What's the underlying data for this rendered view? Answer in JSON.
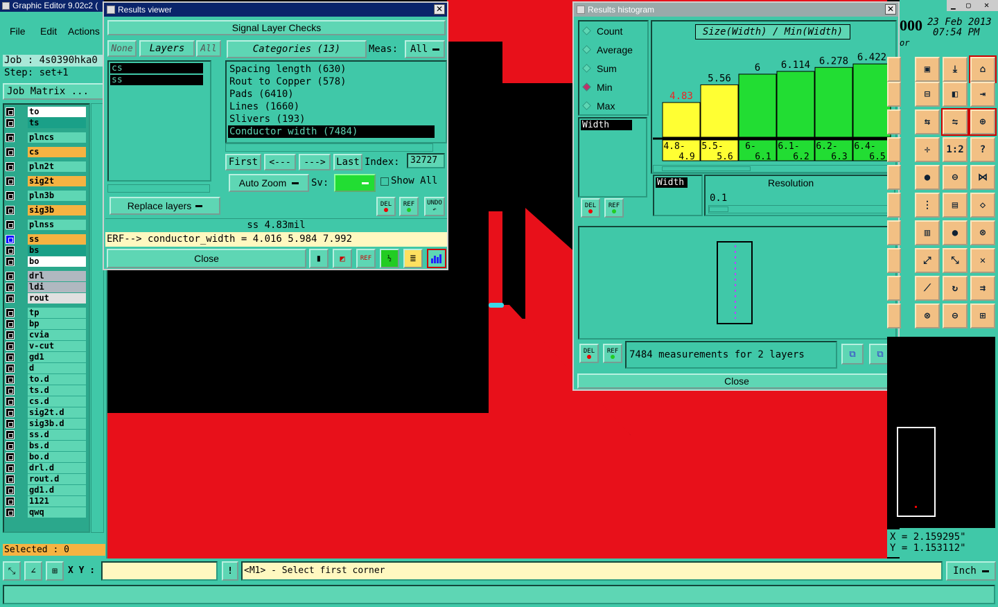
{
  "app": {
    "title": "Graphic Editor 9.02c2 (",
    "menus": [
      "File",
      "Edit",
      "Actions"
    ],
    "job": "Job : 4s0390hka0",
    "step": "Step: set+1",
    "job_matrix": "Job Matrix ...",
    "selected": "Selected : 0",
    "date": "23 Feb 2013",
    "time": "07:54 PM",
    "clock": "000",
    "clock_sub": "or"
  },
  "layers": [
    {
      "name": "to",
      "bg": "#ffffff"
    },
    {
      "name": "ts",
      "bg": "#1aa088"
    },
    {
      "name": "plncs",
      "bg": "#5ed6b4"
    },
    {
      "name": "cs",
      "bg": "#f5b342"
    },
    {
      "name": "pln2t",
      "bg": "#5ed6b4"
    },
    {
      "name": "sig2t",
      "bg": "#f5b342"
    },
    {
      "name": "pln3b",
      "bg": "#5ed6b4"
    },
    {
      "name": "sig3b",
      "bg": "#f5b342"
    },
    {
      "name": "plnss",
      "bg": "#5ed6b4"
    },
    {
      "name": "ss",
      "bg": "#f5b342"
    },
    {
      "name": "bs",
      "bg": "#1aa088"
    },
    {
      "name": "bo",
      "bg": "#ffffff"
    },
    {
      "name": "drl",
      "bg": "#b0b8c0"
    },
    {
      "name": "ldi",
      "bg": "#b0b8c0"
    },
    {
      "name": "rout",
      "bg": "#e0e0e0"
    },
    {
      "name": "tp",
      "bg": "#5ed6b4"
    },
    {
      "name": "bp",
      "bg": "#5ed6b4"
    },
    {
      "name": "cvia",
      "bg": "#5ed6b4"
    },
    {
      "name": "v-cut",
      "bg": "#5ed6b4"
    },
    {
      "name": "gd1",
      "bg": "#5ed6b4"
    },
    {
      "name": "d",
      "bg": "#5ed6b4"
    },
    {
      "name": "to.d",
      "bg": "#5ed6b4"
    },
    {
      "name": "ts.d",
      "bg": "#5ed6b4"
    },
    {
      "name": "cs.d",
      "bg": "#5ed6b4"
    },
    {
      "name": "sig2t.d",
      "bg": "#5ed6b4"
    },
    {
      "name": "sig3b.d",
      "bg": "#5ed6b4"
    },
    {
      "name": "ss.d",
      "bg": "#5ed6b4"
    },
    {
      "name": "bs.d",
      "bg": "#5ed6b4"
    },
    {
      "name": "bo.d",
      "bg": "#5ed6b4"
    },
    {
      "name": "drl.d",
      "bg": "#5ed6b4"
    },
    {
      "name": "rout.d",
      "bg": "#5ed6b4"
    },
    {
      "name": "gd1.d",
      "bg": "#5ed6b4"
    },
    {
      "name": "1121",
      "bg": "#5ed6b4"
    },
    {
      "name": "qwq",
      "bg": "#5ed6b4"
    }
  ],
  "results_viewer": {
    "title": "Results viewer",
    "header": "Signal Layer Checks",
    "btn_none": "None",
    "btn_layers": "Layers",
    "btn_all": "All",
    "categories_btn": "Categories (13)",
    "meas_label": "Meas:",
    "meas_value": "All",
    "layers_list": [
      "cs",
      "ss"
    ],
    "categories": [
      "Spacing length (630)",
      "Rout to Copper (578)",
      "Pads (6410)",
      "Lines (1660)",
      "Slivers (193)",
      "Conductor width (7484)"
    ],
    "nav": {
      "first": "First",
      "prev": "<---",
      "next": "--->",
      "last": "Last",
      "index_label": "Index:",
      "index_value": "32727"
    },
    "auto_zoom": "Auto Zoom",
    "sv_label": "Sv:",
    "show_all": "Show All",
    "replace_layers": "Replace layers",
    "del": "DEL",
    "ref": "REF",
    "undo": "UNDO",
    "status": "ss 4.83mil",
    "erf": "ERF--> conductor_width = 4.016 5.984 7.992",
    "close": "Close"
  },
  "histogram": {
    "title": "Results histogram",
    "chart_title": "Size(Width) / Min(Width)",
    "modes": [
      "Count",
      "Average",
      "Sum",
      "Min",
      "Max"
    ],
    "selected_mode": "Min",
    "list_item": "Width",
    "sel_field": "Width",
    "resolution_label": "Resolution",
    "resolution_value": "0.1",
    "del": "DEL",
    "ref": "REF",
    "summary": "7484 measurements for 2 layers",
    "close": "Close"
  },
  "chart_data": {
    "type": "bar",
    "title": "Size(Width) / Min(Width)",
    "categories": [
      "4.8-4.9",
      "5.5-5.6",
      "6-6.1",
      "6.1-6.2",
      "6.2-6.3",
      "6.4-6.5"
    ],
    "cat_top": [
      "4.8-",
      "5.5-",
      "6-",
      "6.1-",
      "6.2-",
      "6.4-"
    ],
    "cat_bottom": [
      "4.9",
      "5.6",
      "6.1",
      "6.2",
      "6.3",
      "6.5"
    ],
    "values": [
      4.83,
      5.56,
      6,
      6.114,
      6.278,
      6.422
    ],
    "bar_colors": [
      "#ffff33",
      "#ffff33",
      "#22dd33",
      "#22dd33",
      "#22dd33",
      "#22dd33"
    ],
    "label_colors": [
      "#ee2222",
      "#000000",
      "#000000",
      "#000000",
      "#000000",
      "#000000"
    ],
    "ylim": [
      3.4,
      6.6
    ]
  },
  "coords": {
    "x": "X = 2.159295\"",
    "y": "Y = 1.153112\""
  },
  "bottom": {
    "xy_label": "X Y :",
    "xy_value": "",
    "prompt": "<M1> - Select first corner",
    "units": "Inch"
  }
}
